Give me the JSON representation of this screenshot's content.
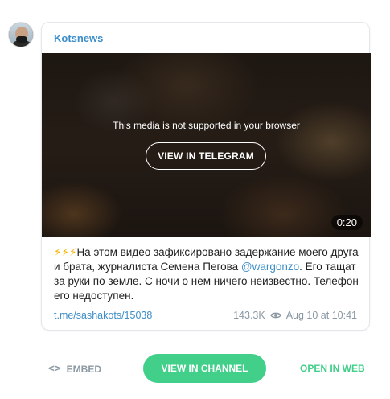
{
  "channel": {
    "name": "Kotsnews"
  },
  "media": {
    "unsupported_message": "This media is not supported in your browser",
    "view_in_telegram_label": "VIEW IN TELEGRAM",
    "duration": "0:20"
  },
  "message": {
    "emoji_prefix": "⚡⚡⚡",
    "text_part1": "На этом видео зафиксировано задержание моего друга и брата, журналиста Семена Пегова ",
    "mention": "@wargonzo",
    "text_part2": ". Его тащат за руки по земле. С ночи о нем ничего неизвестно. Телефон его недоступен."
  },
  "footer": {
    "link": "t.me/sashakots/15038",
    "views": "143.3K",
    "views_icon": "eye-icon",
    "date": "Aug 10 at 10:41"
  },
  "actions": {
    "embed_label": "EMBED",
    "embed_icon": "code-icon",
    "view_channel_label": "VIEW IN CHANNEL",
    "open_web_label": "OPEN IN WEB"
  },
  "colors": {
    "accent_blue": "#3d8ec9",
    "accent_green": "#41cf8a",
    "muted": "#8a97a1"
  }
}
